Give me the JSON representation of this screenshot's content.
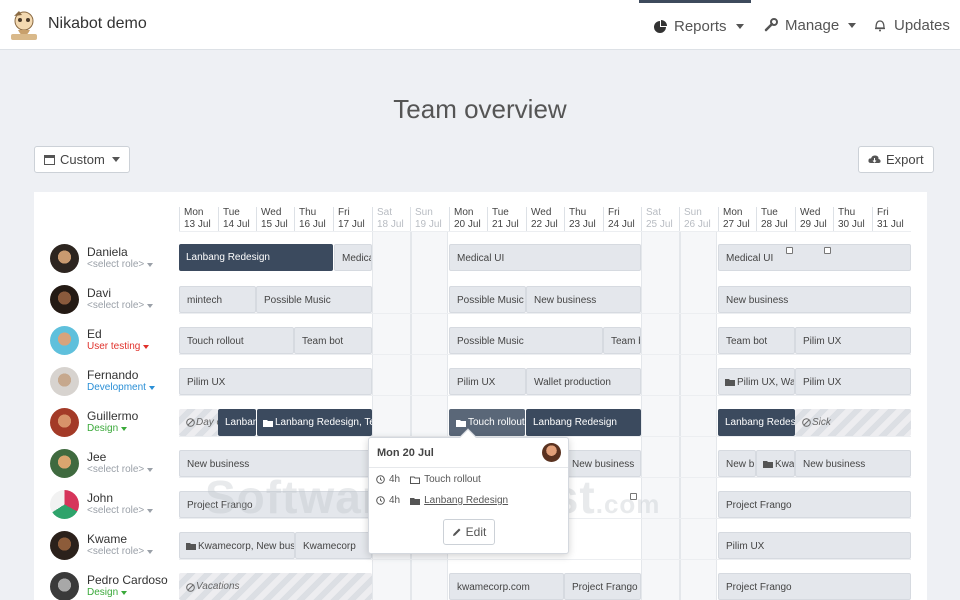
{
  "app": {
    "title": "Nikabot demo"
  },
  "nav": {
    "reports": "Reports",
    "manage": "Manage",
    "updates": "Updates"
  },
  "page": {
    "title": "Team overview"
  },
  "toolbar": {
    "custom_label": "Custom",
    "export_label": "Export"
  },
  "days": [
    {
      "dow": "Mon",
      "date": "13 Jul",
      "weekend": false
    },
    {
      "dow": "Tue",
      "date": "14 Jul",
      "weekend": false
    },
    {
      "dow": "Wed",
      "date": "15 Jul",
      "weekend": false
    },
    {
      "dow": "Thu",
      "date": "16 Jul",
      "weekend": false
    },
    {
      "dow": "Fri",
      "date": "17 Jul",
      "weekend": false
    },
    {
      "dow": "Sat",
      "date": "18 Jul",
      "weekend": true
    },
    {
      "dow": "Sun",
      "date": "19 Jul",
      "weekend": true
    },
    {
      "dow": "Mon",
      "date": "20 Jul",
      "weekend": false
    },
    {
      "dow": "Tue",
      "date": "21 Jul",
      "weekend": false
    },
    {
      "dow": "Wed",
      "date": "22 Jul",
      "weekend": false
    },
    {
      "dow": "Thu",
      "date": "23 Jul",
      "weekend": false
    },
    {
      "dow": "Fri",
      "date": "24 Jul",
      "weekend": false
    },
    {
      "dow": "Sat",
      "date": "25 Jul",
      "weekend": true
    },
    {
      "dow": "Sun",
      "date": "26 Jul",
      "weekend": true
    },
    {
      "dow": "Mon",
      "date": "27 Jul",
      "weekend": false
    },
    {
      "dow": "Tue",
      "date": "28 Jul",
      "weekend": false
    },
    {
      "dow": "Wed",
      "date": "29 Jul",
      "weekend": false
    },
    {
      "dow": "Thu",
      "date": "30 Jul",
      "weekend": false
    },
    {
      "dow": "Fri",
      "date": "31 Jul",
      "weekend": false
    }
  ],
  "people": [
    {
      "name": "Daniela",
      "role": "<select role>",
      "role_color": "#9aa0a8"
    },
    {
      "name": "Davi",
      "role": "<select role>",
      "role_color": "#9aa0a8"
    },
    {
      "name": "Ed",
      "role": "User testing",
      "role_color": "#e0312b"
    },
    {
      "name": "Fernando",
      "role": "Development",
      "role_color": "#2a8fd6"
    },
    {
      "name": "Guillermo",
      "role": "Design",
      "role_color": "#3aa93a"
    },
    {
      "name": "Jee",
      "role": "<select role>",
      "role_color": "#9aa0a8"
    },
    {
      "name": "John",
      "role": "<select role>",
      "role_color": "#9aa0a8"
    },
    {
      "name": "Kwame",
      "role": "<select role>",
      "role_color": "#9aa0a8"
    },
    {
      "name": "Pedro Cardoso",
      "role": "Design",
      "role_color": "#3aa93a"
    }
  ],
  "tasks": {
    "r0": [
      "Lanbang Redesign",
      "Medica",
      "Medical UI",
      "Medical UI"
    ],
    "r1": [
      "mintech",
      "Possible Music",
      "Possible Music",
      "New business",
      "New business"
    ],
    "r2": [
      "Touch rollout",
      "Team bot",
      "Possible Music",
      "Team b",
      "Team bot",
      "Pilim UX"
    ],
    "r3": [
      "Pilim UX",
      "Pilim UX",
      "Wallet production",
      "Pilim UX, Wall",
      "Pilim UX"
    ],
    "r4": [
      "Day o",
      "Lanban",
      "Lanbang Redesign, Tea",
      "Touch rollout,",
      "Lanbang Redesign",
      "Lanbang Redesig",
      "Sick"
    ],
    "r5": [
      "New business",
      "New business",
      "New bu",
      "Kwa",
      "New business"
    ],
    "r6": [
      "Project Frango",
      "Project Frango"
    ],
    "r7": [
      "Kwamecorp, New busir",
      "Kwamecorp",
      "Pilim UX"
    ],
    "r8": [
      "Vacations",
      "kwamecorp.com",
      "Project Frango",
      "Project Frango"
    ]
  },
  "popover": {
    "date": "Mon 20 Jul",
    "entries": [
      {
        "hours": "4h",
        "project": "Touch rollout"
      },
      {
        "hours": "4h",
        "project": "Lanbang Redesign"
      }
    ],
    "edit_label": "Edit"
  },
  "watermark": {
    "main": "SoftwareSuggest",
    "suffix": ".com"
  },
  "colors": {
    "dark_task": "#3b4a5e",
    "light_task": "#e4e7ec",
    "design": "#3aa93a",
    "development": "#2a8fd6",
    "user_testing": "#e0312b"
  }
}
